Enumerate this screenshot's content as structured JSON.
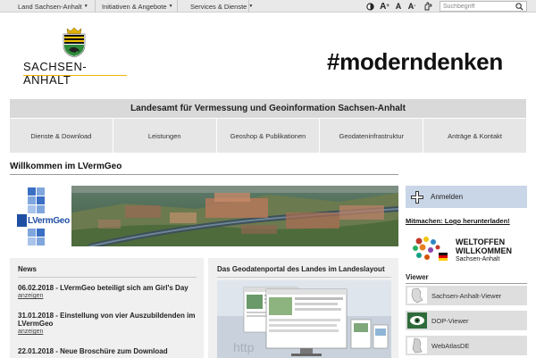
{
  "topbar": {
    "nav": [
      {
        "label": "Land Sachsen-Anhalt"
      },
      {
        "label": "Initiativen & Angebote"
      },
      {
        "label": "Services & Dienste"
      }
    ],
    "tools": {
      "font_large": "A",
      "font_medium": "A",
      "font_small": "A"
    },
    "search": {
      "placeholder": "Suchbegriff"
    }
  },
  "header": {
    "brand": "SACHSEN-ANHALT",
    "hashtag": "#moderndenken"
  },
  "agency": "Landesamt für Vermessung und Geoinformation Sachsen-Anhalt",
  "mainnav": [
    {
      "label": "Dienste & Download"
    },
    {
      "label": "Leistungen"
    },
    {
      "label": "Geoshop & Publikationen"
    },
    {
      "label": "Geodateninfrastruktur"
    },
    {
      "label": "Anträge & Kontakt"
    }
  ],
  "welcome": "Willkommen im LVermGeo",
  "banner_logo": "LVermGeo",
  "news": {
    "heading": "News",
    "items": [
      {
        "title": "06.02.2018 - LVermGeo beteiligt sich am Girl's Day",
        "more": "anzeigen"
      },
      {
        "title": "31.01.2018 - Einstellung von vier Auszubildenden im LVermGeo",
        "more": "anzeigen"
      },
      {
        "title": "22.01.2018 - Neue Broschüre zum Download",
        "more": ""
      }
    ]
  },
  "portal": {
    "heading": "Das Geodatenportal des Landes im Landeslayout"
  },
  "sidebar": {
    "login": "Anmelden",
    "mitmachen": "Mitmachen: Logo herunterladen!",
    "weltoffen": {
      "line1": "WELTOFFEN",
      "line2": "WILLKOMMEN",
      "line3": "Sachsen-Anhalt"
    },
    "viewer_heading": "Viewer",
    "viewers": [
      {
        "label": "Sachsen-Anhalt-Viewer"
      },
      {
        "label": "DOP-Viewer"
      },
      {
        "label": "WebAtlasDE"
      }
    ]
  },
  "colors": {
    "accent_line": "#f0b400",
    "login_bg": "#c9d6e8",
    "logo_blue": "#3a6fc4"
  }
}
